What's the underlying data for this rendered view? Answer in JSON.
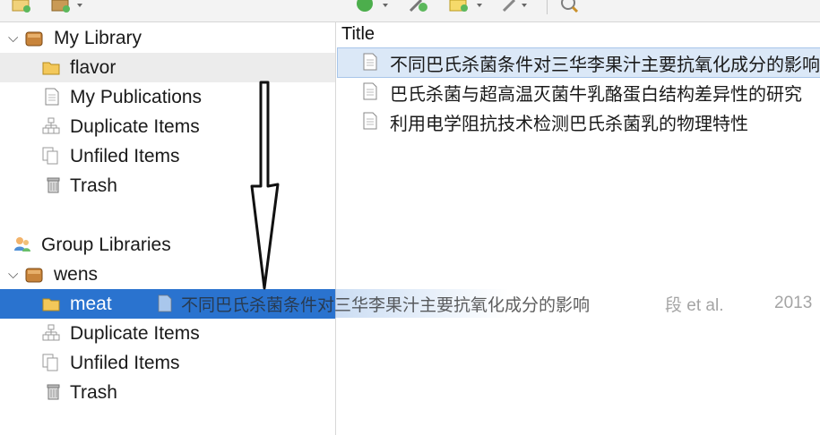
{
  "toolbar": {
    "buttons": [
      {
        "name": "new-collection-icon"
      },
      {
        "name": "new-library-icon"
      },
      {
        "name": "new-item-icon"
      },
      {
        "name": "add-by-identifier-icon"
      },
      {
        "name": "new-note-icon"
      },
      {
        "name": "attachment-icon"
      },
      {
        "name": "search-icon"
      }
    ]
  },
  "sidebar": {
    "my_library": {
      "label": "My Library"
    },
    "items": [
      {
        "label": "flavor"
      },
      {
        "label": "My Publications"
      },
      {
        "label": "Duplicate Items"
      },
      {
        "label": "Unfiled Items"
      },
      {
        "label": "Trash"
      }
    ],
    "group_libraries": {
      "label": "Group Libraries"
    },
    "group": {
      "label": "wens"
    },
    "group_items": [
      {
        "label": "meat"
      },
      {
        "label": "Duplicate Items"
      },
      {
        "label": "Unfiled Items"
      },
      {
        "label": "Trash"
      }
    ]
  },
  "items_pane": {
    "column_title": "Title",
    "rows": [
      {
        "title": "不同巴氏杀菌条件对三华李果汁主要抗氧化成分的影响"
      },
      {
        "title": "巴氏杀菌与超高温灭菌牛乳酪蛋白结构差异性的研究"
      },
      {
        "title": "利用电学阻抗技术检测巴氏杀菌乳的物理特性"
      }
    ]
  },
  "drag_ghost": {
    "title": "不同巴氏杀菌条件对三华李果汁主要抗氧化成分的影响",
    "author": "段 et al.",
    "year": "2013"
  },
  "colors": {
    "selection_blue": "#2a73cf",
    "selection_gray": "#ececec",
    "item_selected": "#dbe8f7"
  }
}
